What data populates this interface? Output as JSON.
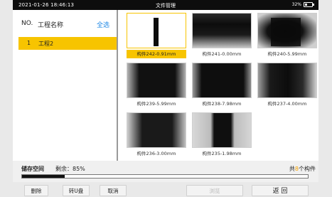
{
  "status_bar": {
    "datetime": "2021-01-26  18:46:13",
    "title": "文件管理",
    "battery_text": "32%",
    "battery_level": 0.32
  },
  "list": {
    "header_no": "NO.",
    "header_name": "工程名称",
    "select_all": "全选",
    "items": [
      {
        "index": "1",
        "name": "工程2"
      }
    ]
  },
  "thumbnails": [
    {
      "caption": "构件242-0.91mm"
    },
    {
      "caption": "构件241-0.00mm"
    },
    {
      "caption": "构件240-5.99mm"
    },
    {
      "caption": "构件239-5.99mm"
    },
    {
      "caption": "构件238-7.98mm"
    },
    {
      "caption": "构件237-4.00mm"
    },
    {
      "caption": "构件236-3.00mm"
    },
    {
      "caption": "构件235-1.98mm"
    }
  ],
  "storage": {
    "label": "储存空间",
    "remaining": "剩余：85%",
    "used_fraction": 0.15,
    "total_prefix": "共",
    "total_count": "8",
    "total_suffix": "个构件"
  },
  "buttons": {
    "delete": "删除",
    "to_usb": "转U盘",
    "cancel": "取消",
    "browse": "浏览",
    "back": "返 回"
  },
  "colors": {
    "accent": "#f7c400",
    "link": "#1e88e5"
  }
}
